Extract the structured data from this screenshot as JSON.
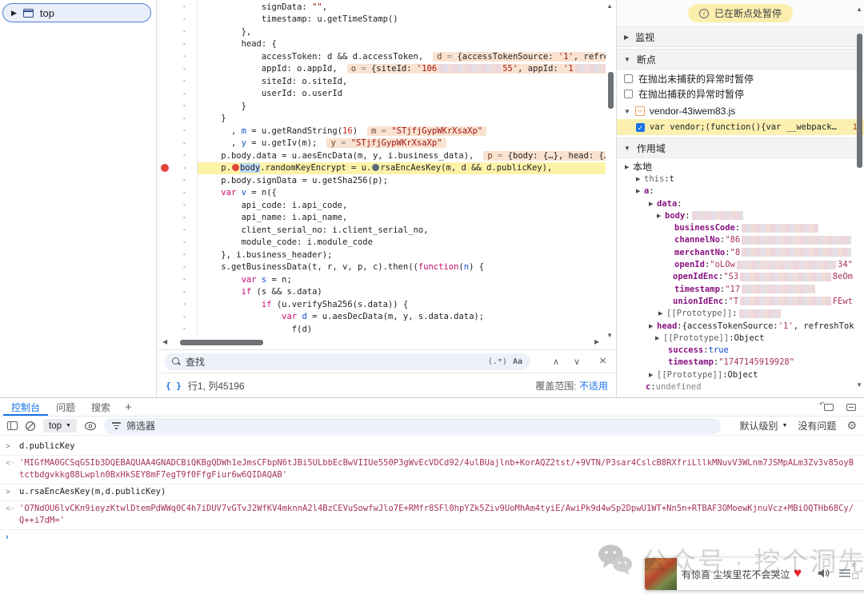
{
  "frames": {
    "top": "top"
  },
  "editor": {
    "lines": [
      {
        "ind": 3,
        "segs": [
          [
            "pl",
            "signData: "
          ],
          [
            "st",
            "\"\""
          ],
          [
            "pl",
            ","
          ]
        ]
      },
      {
        "ind": 3,
        "segs": [
          [
            "pl",
            "timestamp: u.getTimeStamp()"
          ]
        ]
      },
      {
        "ind": 2,
        "segs": [
          [
            "pl",
            "},"
          ]
        ]
      },
      {
        "ind": 2,
        "segs": [
          [
            "pl",
            "head: {"
          ]
        ]
      },
      {
        "ind": 3,
        "segs": [
          [
            "pl",
            "accessToken: d && d.accessToken,"
          ]
        ],
        "pill": [
          [
            "pn",
            "d"
          ],
          [
            "pe",
            " = "
          ],
          [
            "pl",
            "{accessTokenSource: "
          ],
          [
            "ps",
            "'1'"
          ],
          [
            "pl",
            ", refreshTok"
          ]
        ]
      },
      {
        "ind": 3,
        "segs": [
          [
            "pl",
            "appId: o.appId,"
          ]
        ],
        "pill": [
          [
            "pn",
            "o"
          ],
          [
            "pe",
            " = "
          ],
          [
            "pl",
            "{siteId: "
          ],
          [
            "ps",
            "'106"
          ],
          [
            "cz",
            "78"
          ],
          [
            "ps",
            "55'"
          ],
          [
            "pl",
            ", appId: "
          ],
          [
            "ps",
            "'1"
          ],
          [
            "cz",
            "70"
          ]
        ]
      },
      {
        "ind": 3,
        "segs": [
          [
            "pl",
            "siteId: o.siteId,"
          ]
        ]
      },
      {
        "ind": 3,
        "segs": [
          [
            "pl",
            "userId: o.userId"
          ]
        ]
      },
      {
        "ind": 2,
        "segs": [
          [
            "pl",
            "}"
          ]
        ]
      },
      {
        "ind": 1,
        "segs": [
          [
            "pl",
            "}"
          ]
        ]
      },
      {
        "ind": 1,
        "segs": [
          [
            "pl",
            "  , "
          ],
          [
            "df",
            "m"
          ],
          [
            "pl",
            " = u.getRandString("
          ],
          [
            "nu",
            "16"
          ],
          [
            "pl",
            ")"
          ]
        ],
        "pill": [
          [
            "pn",
            "m"
          ],
          [
            "pe",
            " = "
          ],
          [
            "ps",
            "\"STjfjGypWKrXsaXp\""
          ]
        ]
      },
      {
        "ind": 1,
        "segs": [
          [
            "pl",
            "  , "
          ],
          [
            "df",
            "y"
          ],
          [
            "pl",
            " = u.getIv(m);"
          ]
        ],
        "pill": [
          [
            "pn",
            "y"
          ],
          [
            "pe",
            " = "
          ],
          [
            "ps",
            "\"STjfjGypWKrXsaXp\""
          ]
        ]
      },
      {
        "ind": 1,
        "segs": [
          [
            "pl",
            "p.body.data = u.aesEncData(m, y, i.business_data),"
          ]
        ],
        "pill": [
          [
            "pn",
            "p"
          ],
          [
            "pe",
            " = "
          ],
          [
            "pl",
            "{body: {…}, head: {…}}, "
          ]
        ]
      },
      {
        "ind": 1,
        "bp": true,
        "paused": true,
        "segs": [
          [
            "pl",
            "p."
          ],
          [
            "dotR",
            ""
          ],
          [
            "sel",
            "body"
          ],
          [
            "pl",
            ".randomKeyEncrypt = u."
          ],
          [
            "dotG",
            ""
          ],
          [
            "pl",
            "rsaEncAesKey(m, d && d.publicKey),"
          ]
        ]
      },
      {
        "ind": 1,
        "segs": [
          [
            "pl",
            "p.body.signData = u.getSha256(p);"
          ]
        ]
      },
      {
        "ind": 1,
        "segs": [
          [
            "kw",
            "var"
          ],
          [
            "pl",
            " "
          ],
          [
            "df",
            "v"
          ],
          [
            "pl",
            " = n({"
          ]
        ]
      },
      {
        "ind": 2,
        "segs": [
          [
            "pl",
            "api_code: i.api_code,"
          ]
        ]
      },
      {
        "ind": 2,
        "segs": [
          [
            "pl",
            "api_name: i.api_name,"
          ]
        ]
      },
      {
        "ind": 2,
        "segs": [
          [
            "pl",
            "client_serial_no: i.client_serial_no,"
          ]
        ]
      },
      {
        "ind": 2,
        "segs": [
          [
            "pl",
            "module_code: i.module_code"
          ]
        ]
      },
      {
        "ind": 1,
        "segs": [
          [
            "pl",
            "}, i.business_header);"
          ]
        ]
      },
      {
        "ind": 1,
        "segs": [
          [
            "pl",
            "s.getBusinessData(t, r, v, p, c).then(("
          ],
          [
            "kw",
            "function"
          ],
          [
            "pl",
            "("
          ],
          [
            "df",
            "n"
          ],
          [
            "pl",
            ") {"
          ]
        ]
      },
      {
        "ind": 2,
        "segs": [
          [
            "kw",
            "var"
          ],
          [
            "pl",
            " "
          ],
          [
            "df",
            "s"
          ],
          [
            "pl",
            " = n;"
          ]
        ]
      },
      {
        "ind": 2,
        "segs": [
          [
            "kw",
            "if"
          ],
          [
            "pl",
            " (s && s.data)"
          ]
        ]
      },
      {
        "ind": 3,
        "segs": [
          [
            "kw",
            "if"
          ],
          [
            "pl",
            " (u.verifySha256(s.data)) {"
          ]
        ]
      },
      {
        "ind": 4,
        "segs": [
          [
            "kw",
            "var"
          ],
          [
            "pl",
            " "
          ],
          [
            "df",
            "d"
          ],
          [
            "pl",
            " = u.aesDecData(m, y, s.data.data);"
          ]
        ]
      },
      {
        "ind": 4,
        "segs": [
          [
            "pl",
            "  f(d)"
          ]
        ]
      }
    ],
    "search_placeholder": "查找",
    "regex_label": "(.*)",
    "case_label": "Aa",
    "line_col": "行1, 列45196",
    "coverage_label": "覆盖范围:",
    "coverage_value": "不适用"
  },
  "debugger": {
    "paused": "已在断点处暂停",
    "watch": "监视",
    "breakpoints": "断点",
    "scope": "作用域",
    "pause_uncaught": "在抛出未捕获的异常时暂停",
    "pause_caught": "在抛出捕获的异常时暂停",
    "file": "vendor-43iwem83.js",
    "entry_code": "var vendor;(function(){var __webpack…",
    "entry_line": "1",
    "scope_rows": [
      {
        "ind": 10,
        "arrow": true,
        "name": "本地",
        "ncls": "n-root",
        "sep": "",
        "vals": []
      },
      {
        "ind": 24,
        "arrow": true,
        "name": "this",
        "ncls": "n-dim",
        "sep": ": ",
        "vals": [
          [
            "vp",
            "t"
          ]
        ]
      },
      {
        "ind": 24,
        "arrow": true,
        "name": "a",
        "ncls": "n-prop",
        "sep": ": ",
        "vals": []
      },
      {
        "ind": 40,
        "arrow": true,
        "name": "data",
        "ncls": "n-prop",
        "sep": ": ",
        "vals": []
      },
      {
        "ind": 50,
        "arrow": true,
        "name": "body",
        "ncls": "n-prop",
        "sep": ": ",
        "vals": [
          [
            "cz",
            "64"
          ]
        ]
      },
      {
        "ind": 62,
        "arrow": false,
        "name": "businessCode",
        "ncls": "n-prop",
        "sep": ": ",
        "vals": [
          [
            "cz",
            "96"
          ]
        ]
      },
      {
        "ind": 62,
        "arrow": false,
        "name": "channelNo",
        "ncls": "n-prop",
        "sep": ": ",
        "vals": [
          [
            "vs",
            "\"86"
          ],
          [
            "cz",
            "150"
          ]
        ]
      },
      {
        "ind": 62,
        "arrow": false,
        "name": "merchantNo",
        "ncls": "n-prop",
        "sep": ": ",
        "vals": [
          [
            "vs",
            "\"8"
          ],
          [
            "cz",
            "168"
          ]
        ]
      },
      {
        "ind": 62,
        "arrow": false,
        "name": "openId",
        "ncls": "n-prop",
        "sep": ": ",
        "vals": [
          [
            "vs",
            "\"oLOw"
          ],
          [
            "cz",
            "136"
          ],
          [
            "vs",
            "34\""
          ]
        ]
      },
      {
        "ind": 60,
        "arrow": false,
        "name": "openIdEnc",
        "ncls": "n-prop",
        "sep": ": ",
        "vals": [
          [
            "vs",
            "\"S3"
          ],
          [
            "cz",
            "158"
          ],
          [
            "vs",
            "8eOm"
          ]
        ]
      },
      {
        "ind": 62,
        "arrow": false,
        "name": "timestamp",
        "ncls": "n-prop",
        "sep": ": ",
        "vals": [
          [
            "vs",
            "\"17"
          ],
          [
            "cz",
            "92"
          ]
        ]
      },
      {
        "ind": 60,
        "arrow": false,
        "name": "unionIdEnc",
        "ncls": "n-prop",
        "sep": ": ",
        "vals": [
          [
            "vs",
            "\"T"
          ],
          [
            "cz",
            "166"
          ],
          [
            "vs",
            "FEwt"
          ]
        ]
      },
      {
        "ind": 52,
        "arrow": true,
        "name": "[[Prototype]]",
        "ncls": "n-dim",
        "sep": ": ",
        "vals": [
          [
            "cz",
            "52"
          ]
        ]
      },
      {
        "ind": 40,
        "arrow": true,
        "name": "head",
        "ncls": "n-prop",
        "sep": ": ",
        "vals": [
          [
            "vp",
            "{accessTokenSource: "
          ],
          [
            "vs",
            "'1'"
          ],
          [
            "vp",
            ", refreshTok"
          ]
        ]
      },
      {
        "ind": 48,
        "arrow": true,
        "name": "[[Prototype]]",
        "ncls": "n-dim",
        "sep": ": ",
        "vals": [
          [
            "vp",
            "Object"
          ]
        ]
      },
      {
        "ind": 54,
        "arrow": false,
        "name": "success",
        "ncls": "n-prop",
        "sep": ": ",
        "vals": [
          [
            "vb",
            "true"
          ]
        ]
      },
      {
        "ind": 54,
        "arrow": false,
        "name": "timestamp",
        "ncls": "n-prop",
        "sep": ": ",
        "vals": [
          [
            "vs",
            "\"1747145919928\""
          ]
        ]
      },
      {
        "ind": 40,
        "arrow": true,
        "name": "[[Prototype]]",
        "ncls": "n-dim",
        "sep": ": ",
        "vals": [
          [
            "vp",
            "Object"
          ]
        ]
      },
      {
        "ind": 26,
        "arrow": false,
        "name": "c",
        "ncls": "n-prop",
        "sep": ": ",
        "vals": [
          [
            "vu",
            "undefined"
          ]
        ]
      }
    ]
  },
  "console": {
    "tab_console": "控制台",
    "tab_issues": "问题",
    "tab_search": "搜索",
    "context": "top",
    "filter": "筛选器",
    "level": "默认级别",
    "no_issues": "没有问题",
    "messages": [
      {
        "kind": "input",
        "text": "d.publicKey"
      },
      {
        "kind": "result",
        "text": "'MIGfMA0GCSqGSIb3DQEBAQUAA4GNADCBiQKBgQDWh1eJmsCFbpN6tJBi5ULbbEcBwVIIUe550P3gWvEcVDCd92/4ulBUajlnb+KorAQZ2tst/+9VTN/P3sar4CslcB8RXfriLllkMNuvV3WLnm7JSMpALm3Zv3v85oyBtctbdgvkkg88Lwpln0BxHkSEY8mF7egT9f0FfgFiur6w6QIDAQAB'"
      },
      {
        "kind": "input",
        "text": "u.rsaEncAesKey(m,d.publicKey)"
      },
      {
        "kind": "result",
        "text": "'O7NdOU6lvCKn9ieyzKtwlDtemPdWWq0C4h7iDUV7vGTvJ2WfKV4mknnA2l4BzCEVuSowfwJlo7E+RMfr8SFl0hpYZk5Ziv9UoMhAm4tyiE/AwiPk9d4wSp2DpwU1WT+Nn5n+RTBAF3OMoewKjnuVcz+MBiOQTHb68Cy/Q++i7dM='"
      }
    ]
  },
  "overlay": {
    "watermark": "公众号 · 挖个洞先",
    "song": "有惊喜 尘埃里花不会哭泣"
  }
}
